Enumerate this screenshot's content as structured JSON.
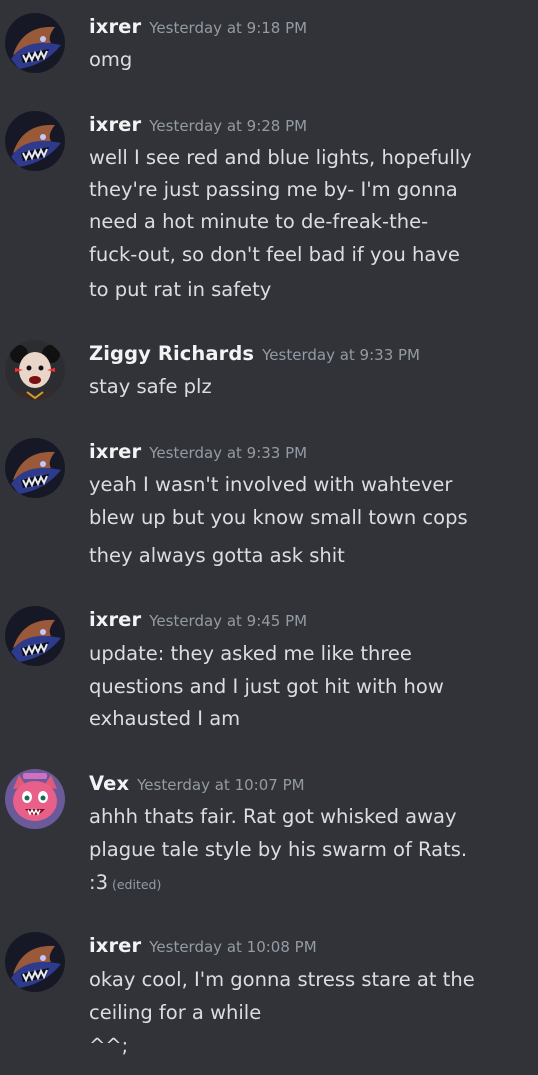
{
  "colors": {
    "background": "#313338",
    "author_text": "#f2f3f5",
    "message_text": "#dbdee1",
    "muted_text": "#949ba4"
  },
  "messages": [
    {
      "author": "ixrer",
      "timestamp": "Yesterday at 9:18 PM",
      "avatar": "shark-mask-avatar",
      "lines": [
        "omg"
      ]
    },
    {
      "author": "ixrer",
      "timestamp": "Yesterday at 9:28 PM",
      "avatar": "shark-mask-avatar",
      "lines": [
        "well I see red and blue lights, hopefully",
        "they're just passing me by- I'm gonna",
        "need a hot minute to de-freak-the-",
        "fuck-out, so don't feel bad if you have",
        "to put rat in safety"
      ]
    },
    {
      "author": "Ziggy Richards",
      "timestamp": "Yesterday at 9:33 PM",
      "avatar": "clown-avatar",
      "lines": [
        "stay safe plz"
      ]
    },
    {
      "author": "ixrer",
      "timestamp": "Yesterday at 9:33 PM",
      "avatar": "shark-mask-avatar",
      "lines": [
        "yeah I wasn't involved with wahtever",
        "blew up but you know small town cops",
        "they always gotta ask shit"
      ]
    },
    {
      "author": "ixrer",
      "timestamp": "Yesterday at 9:45 PM",
      "avatar": "shark-mask-avatar",
      "lines": [
        "update: they asked me like three",
        "questions and I just got hit with how",
        "exhausted I am"
      ]
    },
    {
      "author": "Vex",
      "timestamp": "Yesterday at 10:07 PM",
      "avatar": "pink-creature-avatar",
      "lines": [
        "ahhh thats fair. Rat got whisked away",
        "plague tale style by his swarm of Rats.",
        ":3"
      ],
      "edited_label": "(edited)"
    },
    {
      "author": "ixrer",
      "timestamp": "Yesterday at 10:08 PM",
      "avatar": "shark-mask-avatar",
      "lines": [
        "okay cool, I'm gonna stress stare at the",
        "ceiling for a while",
        "^^;"
      ]
    }
  ]
}
